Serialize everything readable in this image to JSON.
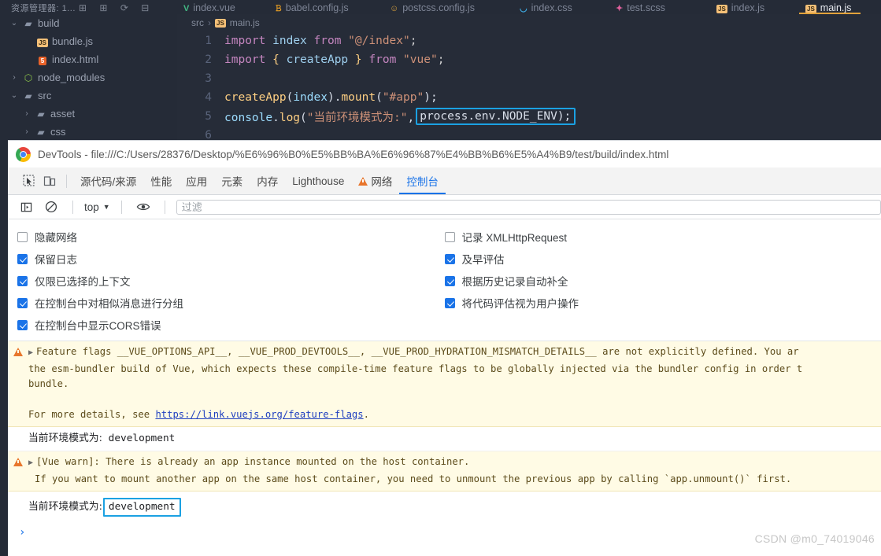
{
  "editor": {
    "sidebar_header": "资源管理器: 1...",
    "sidebar_icons": [
      "new-file-icon",
      "new-folder-icon",
      "refresh-icon",
      "collapse-icon"
    ],
    "tabs": [
      {
        "label": "index.vue",
        "icon": "vue-icon",
        "active": false
      },
      {
        "label": "babel.config.js",
        "icon": "babel-icon",
        "active": false
      },
      {
        "label": "postcss.config.js",
        "icon": "postcss-icon",
        "active": false
      },
      {
        "label": "index.css",
        "icon": "css-icon",
        "active": false
      },
      {
        "label": "test.scss",
        "icon": "sass-icon",
        "active": false
      },
      {
        "label": "index.js",
        "icon": "js-icon",
        "active": false
      },
      {
        "label": "main.js",
        "icon": "js-icon",
        "active": true
      }
    ],
    "tree": [
      {
        "label": "build",
        "icon": "folder-icon",
        "chevron": "v",
        "indent": 0
      },
      {
        "label": "bundle.js",
        "icon": "js-file-icon",
        "chevron": "",
        "indent": 1
      },
      {
        "label": "index.html",
        "icon": "html-file-icon",
        "chevron": "",
        "indent": 1
      },
      {
        "label": "node_modules",
        "icon": "node-icon",
        "chevron": ">",
        "indent": 0
      },
      {
        "label": "src",
        "icon": "folder-icon",
        "chevron": "v",
        "indent": 0
      },
      {
        "label": "asset",
        "icon": "folder-icon",
        "chevron": ">",
        "indent": 1
      },
      {
        "label": "css",
        "icon": "folder-icon",
        "chevron": ">",
        "indent": 1
      }
    ],
    "breadcrumb": [
      "src",
      "main.js"
    ],
    "code_lines": [
      {
        "n": "1",
        "text": "import index from \"@/index\";"
      },
      {
        "n": "2",
        "text": "import { createApp } from \"vue\";"
      },
      {
        "n": "3",
        "text": ""
      },
      {
        "n": "4",
        "text": "createApp(index).mount(\"#app\");"
      },
      {
        "n": "5",
        "text": "console.log(\"当前环境模式为:\", process.env.NODE_ENV);"
      },
      {
        "n": "6",
        "text": ""
      }
    ],
    "highlight_code": "process.env.NODE_ENV);",
    "highlight_color": "#1ba1e2"
  },
  "devtools": {
    "window_title": "DevTools - file:///C:/Users/28376/Desktop/%E6%96%B0%E5%BB%BA%E6%96%87%E4%BB%B6%E5%A4%B9/test/build/index.html",
    "tabs": [
      {
        "label": "源代码/来源",
        "active": false,
        "warn": false
      },
      {
        "label": "性能",
        "active": false,
        "warn": false
      },
      {
        "label": "应用",
        "active": false,
        "warn": false
      },
      {
        "label": "元素",
        "active": false,
        "warn": false
      },
      {
        "label": "内存",
        "active": false,
        "warn": false
      },
      {
        "label": "Lighthouse",
        "active": false,
        "warn": false
      },
      {
        "label": "网络",
        "active": false,
        "warn": true
      },
      {
        "label": "控制台",
        "active": true,
        "warn": false
      }
    ],
    "accent_color": "#1a73e8",
    "console_bar": {
      "context": "top",
      "filter_placeholder": "过滤",
      "filter_value": ""
    },
    "settings_left": [
      {
        "label": "隐藏网络",
        "checked": false
      },
      {
        "label": "保留日志",
        "checked": true
      },
      {
        "label": "仅限已选择的上下文",
        "checked": true
      },
      {
        "label": "在控制台中对相似消息进行分组",
        "checked": true
      },
      {
        "label": "在控制台中显示CORS错误",
        "checked": true
      }
    ],
    "settings_right": [
      {
        "label": "记录 XMLHttpRequest",
        "checked": false
      },
      {
        "label": "及早评估",
        "checked": true
      },
      {
        "label": "根据历史记录自动补全",
        "checked": true
      },
      {
        "label": "将代码评估视为用户操作",
        "checked": true
      }
    ],
    "logs": {
      "warn1_line1": "Feature flags __VUE_OPTIONS_API__, __VUE_PROD_DEVTOOLS__, __VUE_PROD_HYDRATION_MISMATCH_DETAILS__ are not explicitly defined. You ar",
      "warn1_line2": "the esm-bundler build of Vue, which expects these compile-time feature flags to be globally injected via the bundler config in order t",
      "warn1_line3": "bundle.",
      "warn1_line4_pre": "For more details, see ",
      "warn1_link": "https://link.vuejs.org/feature-flags",
      "warn1_line4_post": ".",
      "log1_label": "当前环境模式为:",
      "log1_value": "development",
      "warn2_line1": "[Vue warn]: There is already an app instance mounted on the host container.",
      "warn2_line2": "If you want to mount another app on the same host container, you need to unmount the previous app by calling `app.unmount()` first.",
      "log2_label": "当前环境模式为:",
      "log2_value": "development",
      "prompt_symbol": "›"
    },
    "watermark": "CSDN @m0_74019046"
  }
}
